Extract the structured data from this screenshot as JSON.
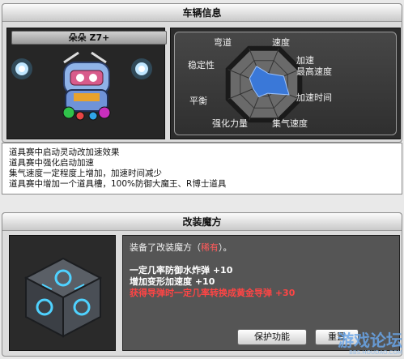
{
  "vehicle": {
    "header": "车辆信息",
    "car_name": "朵朵 Z7+",
    "stats": {
      "labels": [
        "弯道",
        "速度",
        "加速",
        "最高速度",
        "加速时间",
        "集气速度",
        "强化力量",
        "平衡",
        "稳定性"
      ],
      "values": [
        0.3,
        0.55,
        0.7,
        0.25,
        0.35,
        0.3,
        0.4,
        0.5,
        0.35
      ]
    },
    "description": [
      "道具赛中启动灵动改加速效果",
      "道具赛中强化启动加速",
      "集气速度一定程度上增加，加速时间减少",
      "道具赛中增加一个道具槽，100%防御大魔王、R博士道具"
    ]
  },
  "magic": {
    "header": "改装魔方",
    "equipped_prefix": "装备了改装魔方（",
    "equipped_rarity": "稀有",
    "equipped_suffix": "）。",
    "effects": [
      "一定几率防御水炸弹 +10",
      "增加变形加速度 +10"
    ],
    "effect_red": "获得导弹时一定几率转换成黄金导弹 +30",
    "protect_button": "保护功能",
    "reset_button": "重置"
  },
  "watermark": {
    "text": "游戏论坛",
    "url": "BBS.HOUDAO.COM"
  },
  "colors": {
    "radar_fill": "#3a78d8",
    "rare_text": "#ff5a5a",
    "panel_bg": "#dcdcdc"
  }
}
